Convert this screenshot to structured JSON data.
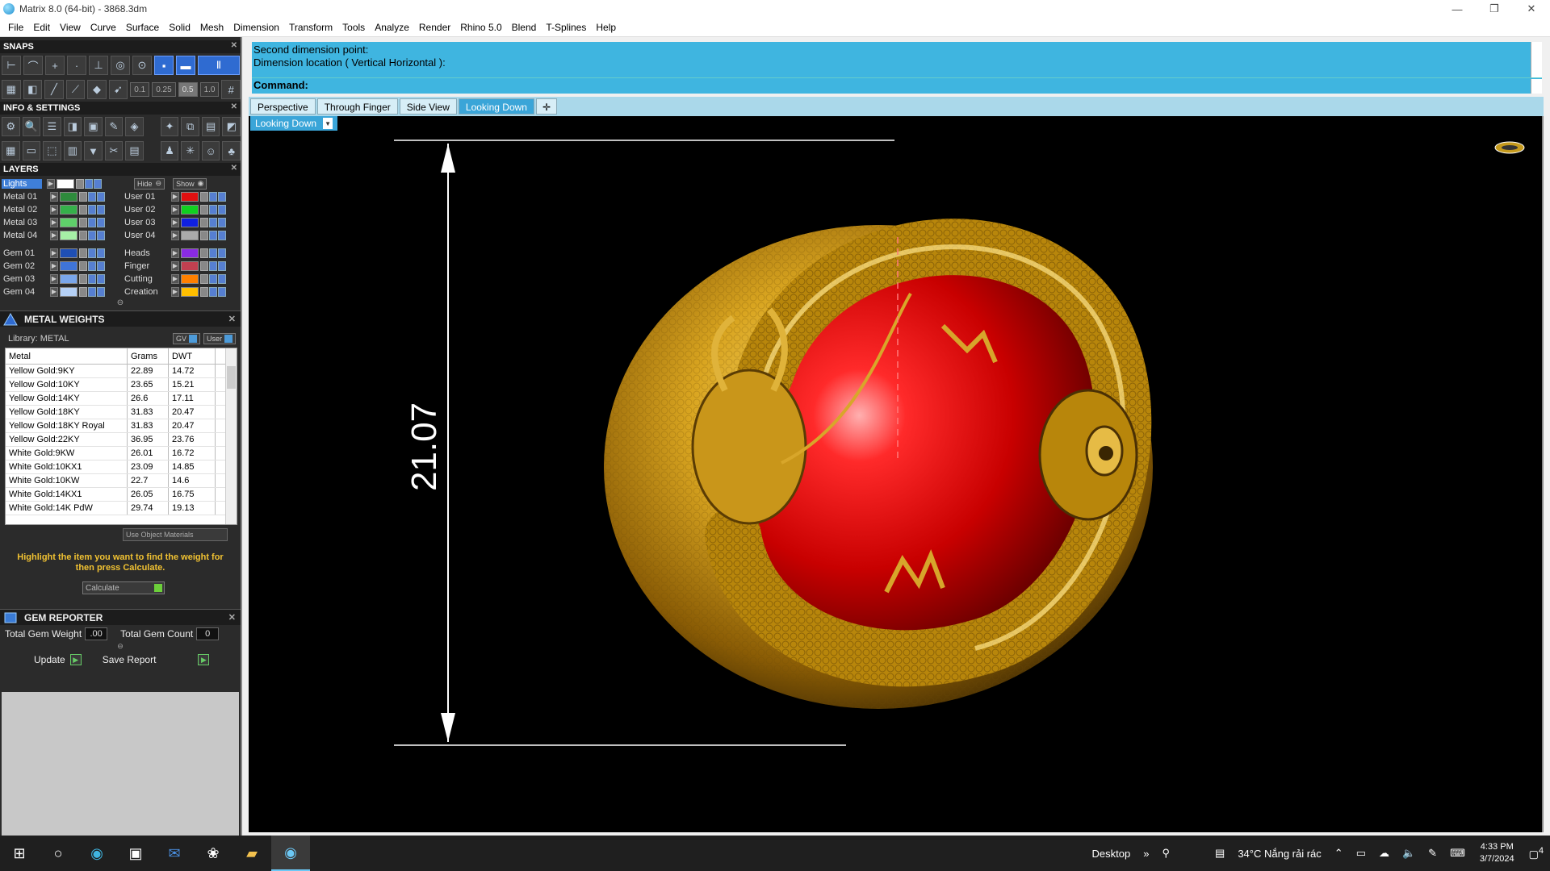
{
  "window": {
    "title": "Matrix 8.0 (64-bit) - 3868.3dm",
    "controls": [
      "—",
      "❐",
      "✕"
    ]
  },
  "menu": [
    "File",
    "Edit",
    "View",
    "Curve",
    "Surface",
    "Solid",
    "Mesh",
    "Dimension",
    "Transform",
    "Tools",
    "Analyze",
    "Render",
    "Rhino 5.0",
    "Blend",
    "T-Splines",
    "Help"
  ],
  "panels": {
    "snaps": "SNAPS",
    "info": "INFO & SETTINGS",
    "layers": "LAYERS",
    "snap_values": [
      "0.1",
      "0.25",
      "0.5",
      "1.0"
    ]
  },
  "layers": {
    "lights": "Lights",
    "hide": "Hide",
    "show": "Show",
    "left": [
      {
        "name": "Metal 01",
        "color": "#2e8b3c"
      },
      {
        "name": "Metal 02",
        "color": "#35b04a"
      },
      {
        "name": "Metal 03",
        "color": "#5fd06a"
      },
      {
        "name": "Metal 04",
        "color": "#a6f0a6"
      },
      {
        "name": "Gem 01",
        "color": "#1f4fb5"
      },
      {
        "name": "Gem 02",
        "color": "#3f74d8"
      },
      {
        "name": "Gem 03",
        "color": "#7aa6ea"
      },
      {
        "name": "Gem 04",
        "color": "#b5d0f5"
      }
    ],
    "right": [
      {
        "name": "User 01",
        "color": "#e01010"
      },
      {
        "name": "User 02",
        "color": "#10d020"
      },
      {
        "name": "User 03",
        "color": "#1020e0"
      },
      {
        "name": "User 04",
        "color": "#aaaaaa"
      },
      {
        "name": "Heads",
        "color": "#8a2be2"
      },
      {
        "name": "Finger",
        "color": "#c04050"
      },
      {
        "name": "Cutting",
        "color": "#ff8000"
      },
      {
        "name": "Creation",
        "color": "#ffbf00"
      }
    ]
  },
  "metal_weights": {
    "title": "METAL WEIGHTS",
    "library": "Library: METAL",
    "gv": "GV",
    "user": "User",
    "headers": [
      "Metal",
      "Grams",
      "DWT"
    ],
    "rows": [
      [
        "Yellow Gold:9KY",
        "22.89",
        "14.72"
      ],
      [
        "Yellow Gold:10KY",
        "23.65",
        "15.21"
      ],
      [
        "Yellow Gold:14KY",
        "26.6",
        "17.11"
      ],
      [
        "Yellow Gold:18KY",
        "31.83",
        "20.47"
      ],
      [
        "Yellow Gold:18KY Royal",
        "31.83",
        "20.47"
      ],
      [
        "Yellow Gold:22KY",
        "36.95",
        "23.76"
      ],
      [
        "White Gold:9KW",
        "26.01",
        "16.72"
      ],
      [
        "White Gold:10KX1",
        "23.09",
        "14.85"
      ],
      [
        "White Gold:10KW",
        "22.7",
        "14.6"
      ],
      [
        "White Gold:14KX1",
        "26.05",
        "16.75"
      ],
      [
        "White Gold:14K PdW",
        "29.74",
        "19.13"
      ]
    ],
    "use_object_materials": "Use Object Materials",
    "hint": "Highlight the item you want to find the weight for then press Calculate.",
    "calculate": "Calculate"
  },
  "gem_reporter": {
    "title": "GEM REPORTER",
    "total_weight_label": "Total Gem Weight",
    "total_weight": ".00",
    "total_count_label": "Total Gem Count",
    "total_count": "0",
    "update": "Update",
    "save_report": "Save Report"
  },
  "command": {
    "line1": "Second dimension point:",
    "line2": "Dimension location ( Vertical  Horizontal ):",
    "prompt": "Command:",
    "value": ""
  },
  "tabs": [
    "Perspective",
    "Through Finger",
    "Side View",
    "Looking Down"
  ],
  "active_tab": "Looking Down",
  "viewport": {
    "label": "Looking Down",
    "dimension": "21.07"
  },
  "taskbar": {
    "desktop": "Desktop",
    "weather": "34°C  Nắng rải rác",
    "time": "4:33 PM",
    "date": "3/7/2024",
    "notifications": "4"
  },
  "colors": {
    "command_bg": "#3fb5e0",
    "active_tab": "#3aa5d8",
    "gold": "#d4a017",
    "red_sphere": "#d90000"
  }
}
